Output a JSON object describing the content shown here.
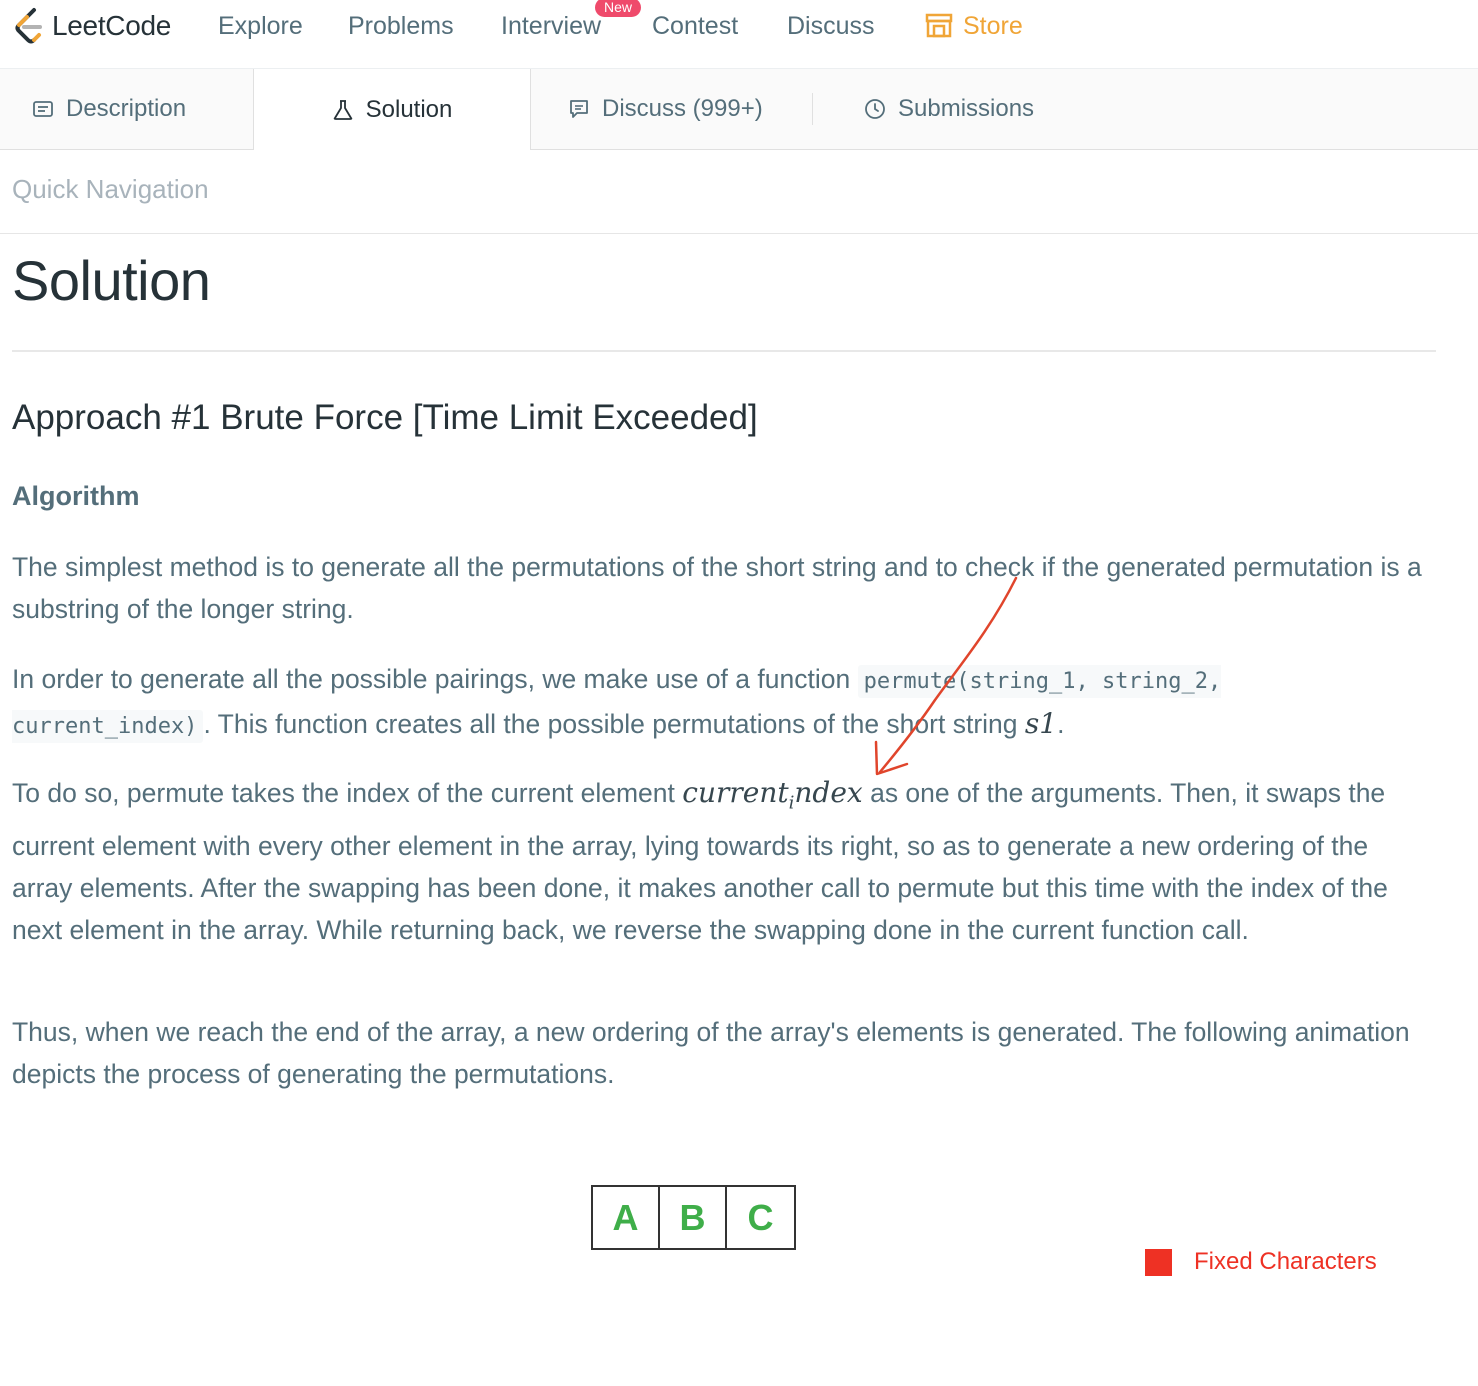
{
  "nav": {
    "logo_text": "LeetCode",
    "items": [
      "Explore",
      "Problems",
      "Interview",
      "Contest",
      "Discuss"
    ],
    "badge": "New",
    "store": "Store"
  },
  "tabs": {
    "description": "Description",
    "solution": "Solution",
    "discuss": "Discuss (999+)",
    "submissions": "Submissions"
  },
  "quick_nav": "Quick Navigation",
  "article": {
    "title": "Solution",
    "approach": "Approach #1 Brute Force [Time Limit Exceeded]",
    "algorithm": "Algorithm",
    "p1": "The simplest method is to generate all the permutations of the short string and to check if the generated permutation is a substring of the longer string.",
    "p2_a": "In order to generate all the possible pairings, we make use of a function",
    "p2_code": "permute(string_1, string_2, current_index)",
    "p2_b": ". This function creates all the possible permutations of the short string",
    "p2_math": "s1",
    "p2_end": ".",
    "p3_a": "To do so, permute takes the index of the current element",
    "p3_math_a": "current",
    "p3_math_sub": "i",
    "p3_math_b": "ndex",
    "p3_b": "as one of the arguments. Then, it swaps the current element with every other element in the array, lying towards its right, so as to generate a new ordering of the array elements. After the swapping has been done, it makes another call to permute but this time with the index of the next element in the array. While returning back, we reverse the swapping done in the current function call.",
    "p4": "Thus, when we reach the end of the array, a new ordering of the array's elements is generated. The following animation depicts the process of generating the permutations."
  },
  "animation": {
    "cells": [
      "A",
      "B",
      "C"
    ],
    "legend": "Fixed Characters",
    "legend_color": "#ee3124",
    "cell_color": "#3fae49"
  },
  "colors": {
    "accent": "#f0a537",
    "badge": "#ef4a6b",
    "arrow": "#e0452c"
  }
}
